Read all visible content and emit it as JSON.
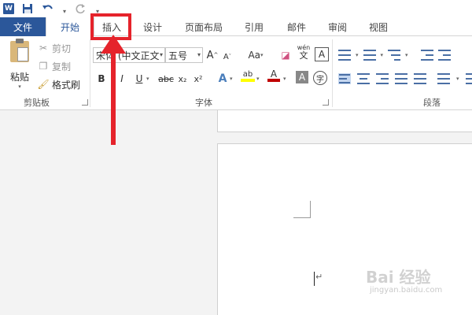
{
  "quick_access": {
    "logo_letter": "W",
    "icons": [
      "word-logo",
      "save-icon",
      "undo-icon",
      "redo-icon",
      "customize-icon"
    ]
  },
  "tabs": [
    {
      "key": "file",
      "label": "文件"
    },
    {
      "key": "home",
      "label": "开始"
    },
    {
      "key": "insert",
      "label": "插入"
    },
    {
      "key": "design",
      "label": "设计"
    },
    {
      "key": "layout",
      "label": "页面布局"
    },
    {
      "key": "references",
      "label": "引用"
    },
    {
      "key": "mailings",
      "label": "邮件"
    },
    {
      "key": "review",
      "label": "审阅"
    },
    {
      "key": "view",
      "label": "视图"
    }
  ],
  "clipboard": {
    "paste_label": "粘贴",
    "cut_label": "剪切",
    "copy_label": "复制",
    "format_painter_label": "格式刷",
    "group_label": "剪贴板"
  },
  "font": {
    "font_name": "宋体 (中文正文",
    "font_size": "五号",
    "grow_label": "A",
    "shrink_label": "A",
    "case_label": "Aa",
    "phonetic_label": "wén",
    "phonetic_sub": "文",
    "border_char_label": "A",
    "bold": "B",
    "italic": "I",
    "underline": "U",
    "strike": "abc",
    "subscript": "x₂",
    "superscript": "x²",
    "text_effect": "A",
    "highlight": "ab",
    "font_color": "A",
    "char_shading": "A",
    "enclose_char": "字",
    "group_label": "字体"
  },
  "paragraph": {
    "group_label": "段落"
  },
  "watermark": {
    "brand": "Bai 经验",
    "url": "jingyan.baidu.com"
  },
  "colors": {
    "word_blue": "#2b579a",
    "annotation_red": "#e5232b",
    "highlight_yellow": "#ffff00",
    "font_red": "#c00000"
  }
}
